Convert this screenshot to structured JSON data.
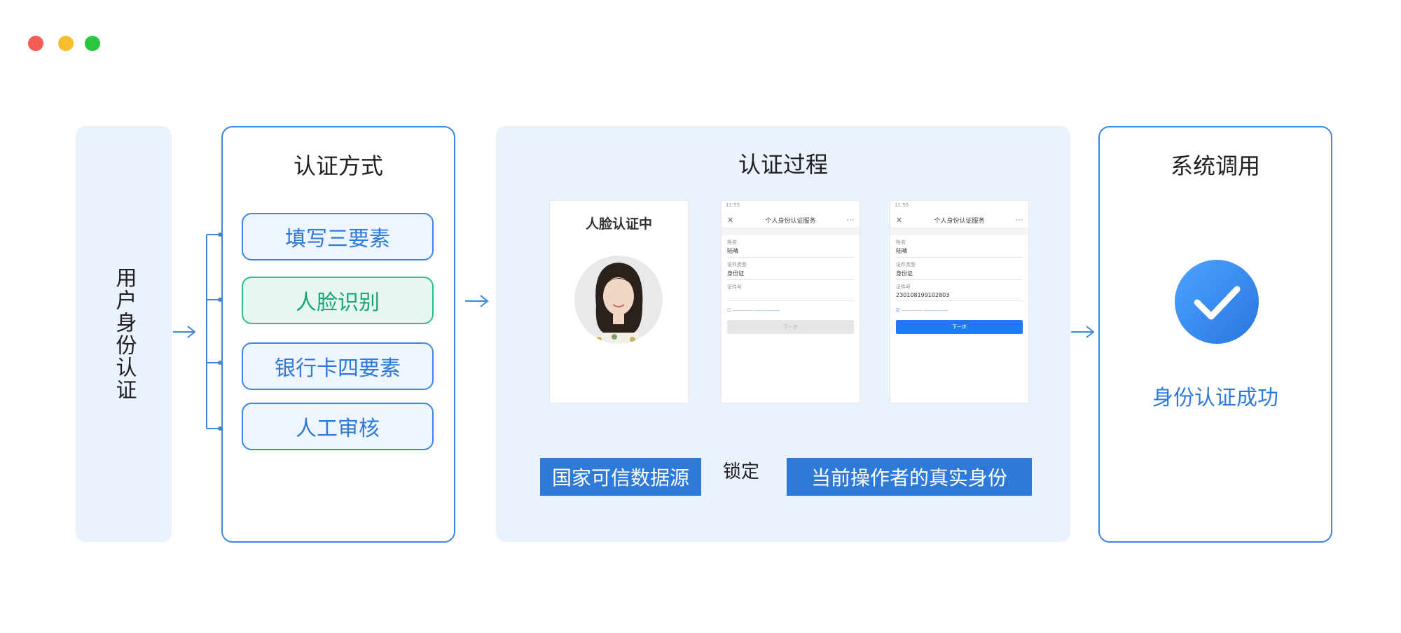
{
  "window": {
    "dots": [
      "#f25c55",
      "#f6bd2f",
      "#2bc640"
    ]
  },
  "user_panel": {
    "label": "用户身份认证"
  },
  "methods": {
    "title": "认证方式",
    "items": [
      "填写三要素",
      "人脸识别",
      "银行卡四要素",
      "人工审核"
    ],
    "active_index": 1
  },
  "process": {
    "title": "认证过程",
    "face_screen_title": "人脸认证中",
    "phone_nav_title": "个人身份认证服务",
    "phone1": {
      "time": "11:55",
      "name_label": "姓名",
      "name_value": "陆晴",
      "type_label": "证件类型",
      "type_value": "身份证",
      "id_label": "证件号",
      "id_value": "",
      "button": "下一步"
    },
    "phone2": {
      "time": "11:56",
      "name_label": "姓名",
      "name_value": "陆晴",
      "type_label": "证件类型",
      "type_value": "身份证",
      "id_label": "证件号",
      "id_value": "230108199102803",
      "button": "下一步"
    },
    "source_tag": "国家可信数据源",
    "lock_label": "锁定",
    "target_tag": "当前操作者的真实身份"
  },
  "system": {
    "title": "系统调用",
    "result": "身份认证成功"
  },
  "colors": {
    "accent": "#2f7ad8",
    "active_green": "#2dbf8c",
    "panel_bg": "#eaf2fe"
  }
}
